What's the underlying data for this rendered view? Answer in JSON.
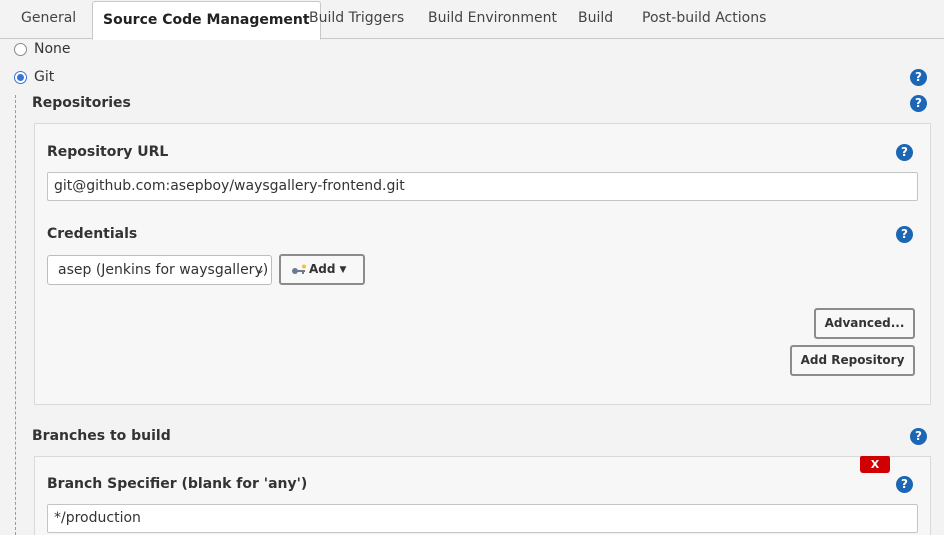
{
  "tabs": [
    {
      "label": "General",
      "active": false
    },
    {
      "label": "Source Code Management",
      "active": true
    },
    {
      "label": "Build Triggers",
      "active": false
    },
    {
      "label": "Build Environment",
      "active": false
    },
    {
      "label": "Build",
      "active": false
    },
    {
      "label": "Post-build Actions",
      "active": false
    }
  ],
  "scm": {
    "options": [
      {
        "label": "None",
        "checked": false
      },
      {
        "label": "Git",
        "checked": true
      }
    ],
    "help_glyph": "?",
    "repositories_label": "Repositories",
    "repository": {
      "url_label": "Repository URL",
      "url_value": "git@github.com:asepboy/waysgallery-frontend.git",
      "credentials_label": "Credentials",
      "credentials_selected": "asep (Jenkins for waysgallery)",
      "add_label": "Add",
      "add_icon": "key-icon",
      "advanced_label": "Advanced...",
      "add_repository_label": "Add Repository"
    },
    "branches_label": "Branches to build",
    "branch": {
      "delete_label": "X",
      "specifier_label": "Branch Specifier (blank for 'any')",
      "specifier_value": "*/production"
    }
  },
  "colors": {
    "help_icon": "#1b66b5",
    "radio_checked": "#3873d8",
    "delete_button": "#d00000",
    "page_bg": "#f3f3f3"
  }
}
